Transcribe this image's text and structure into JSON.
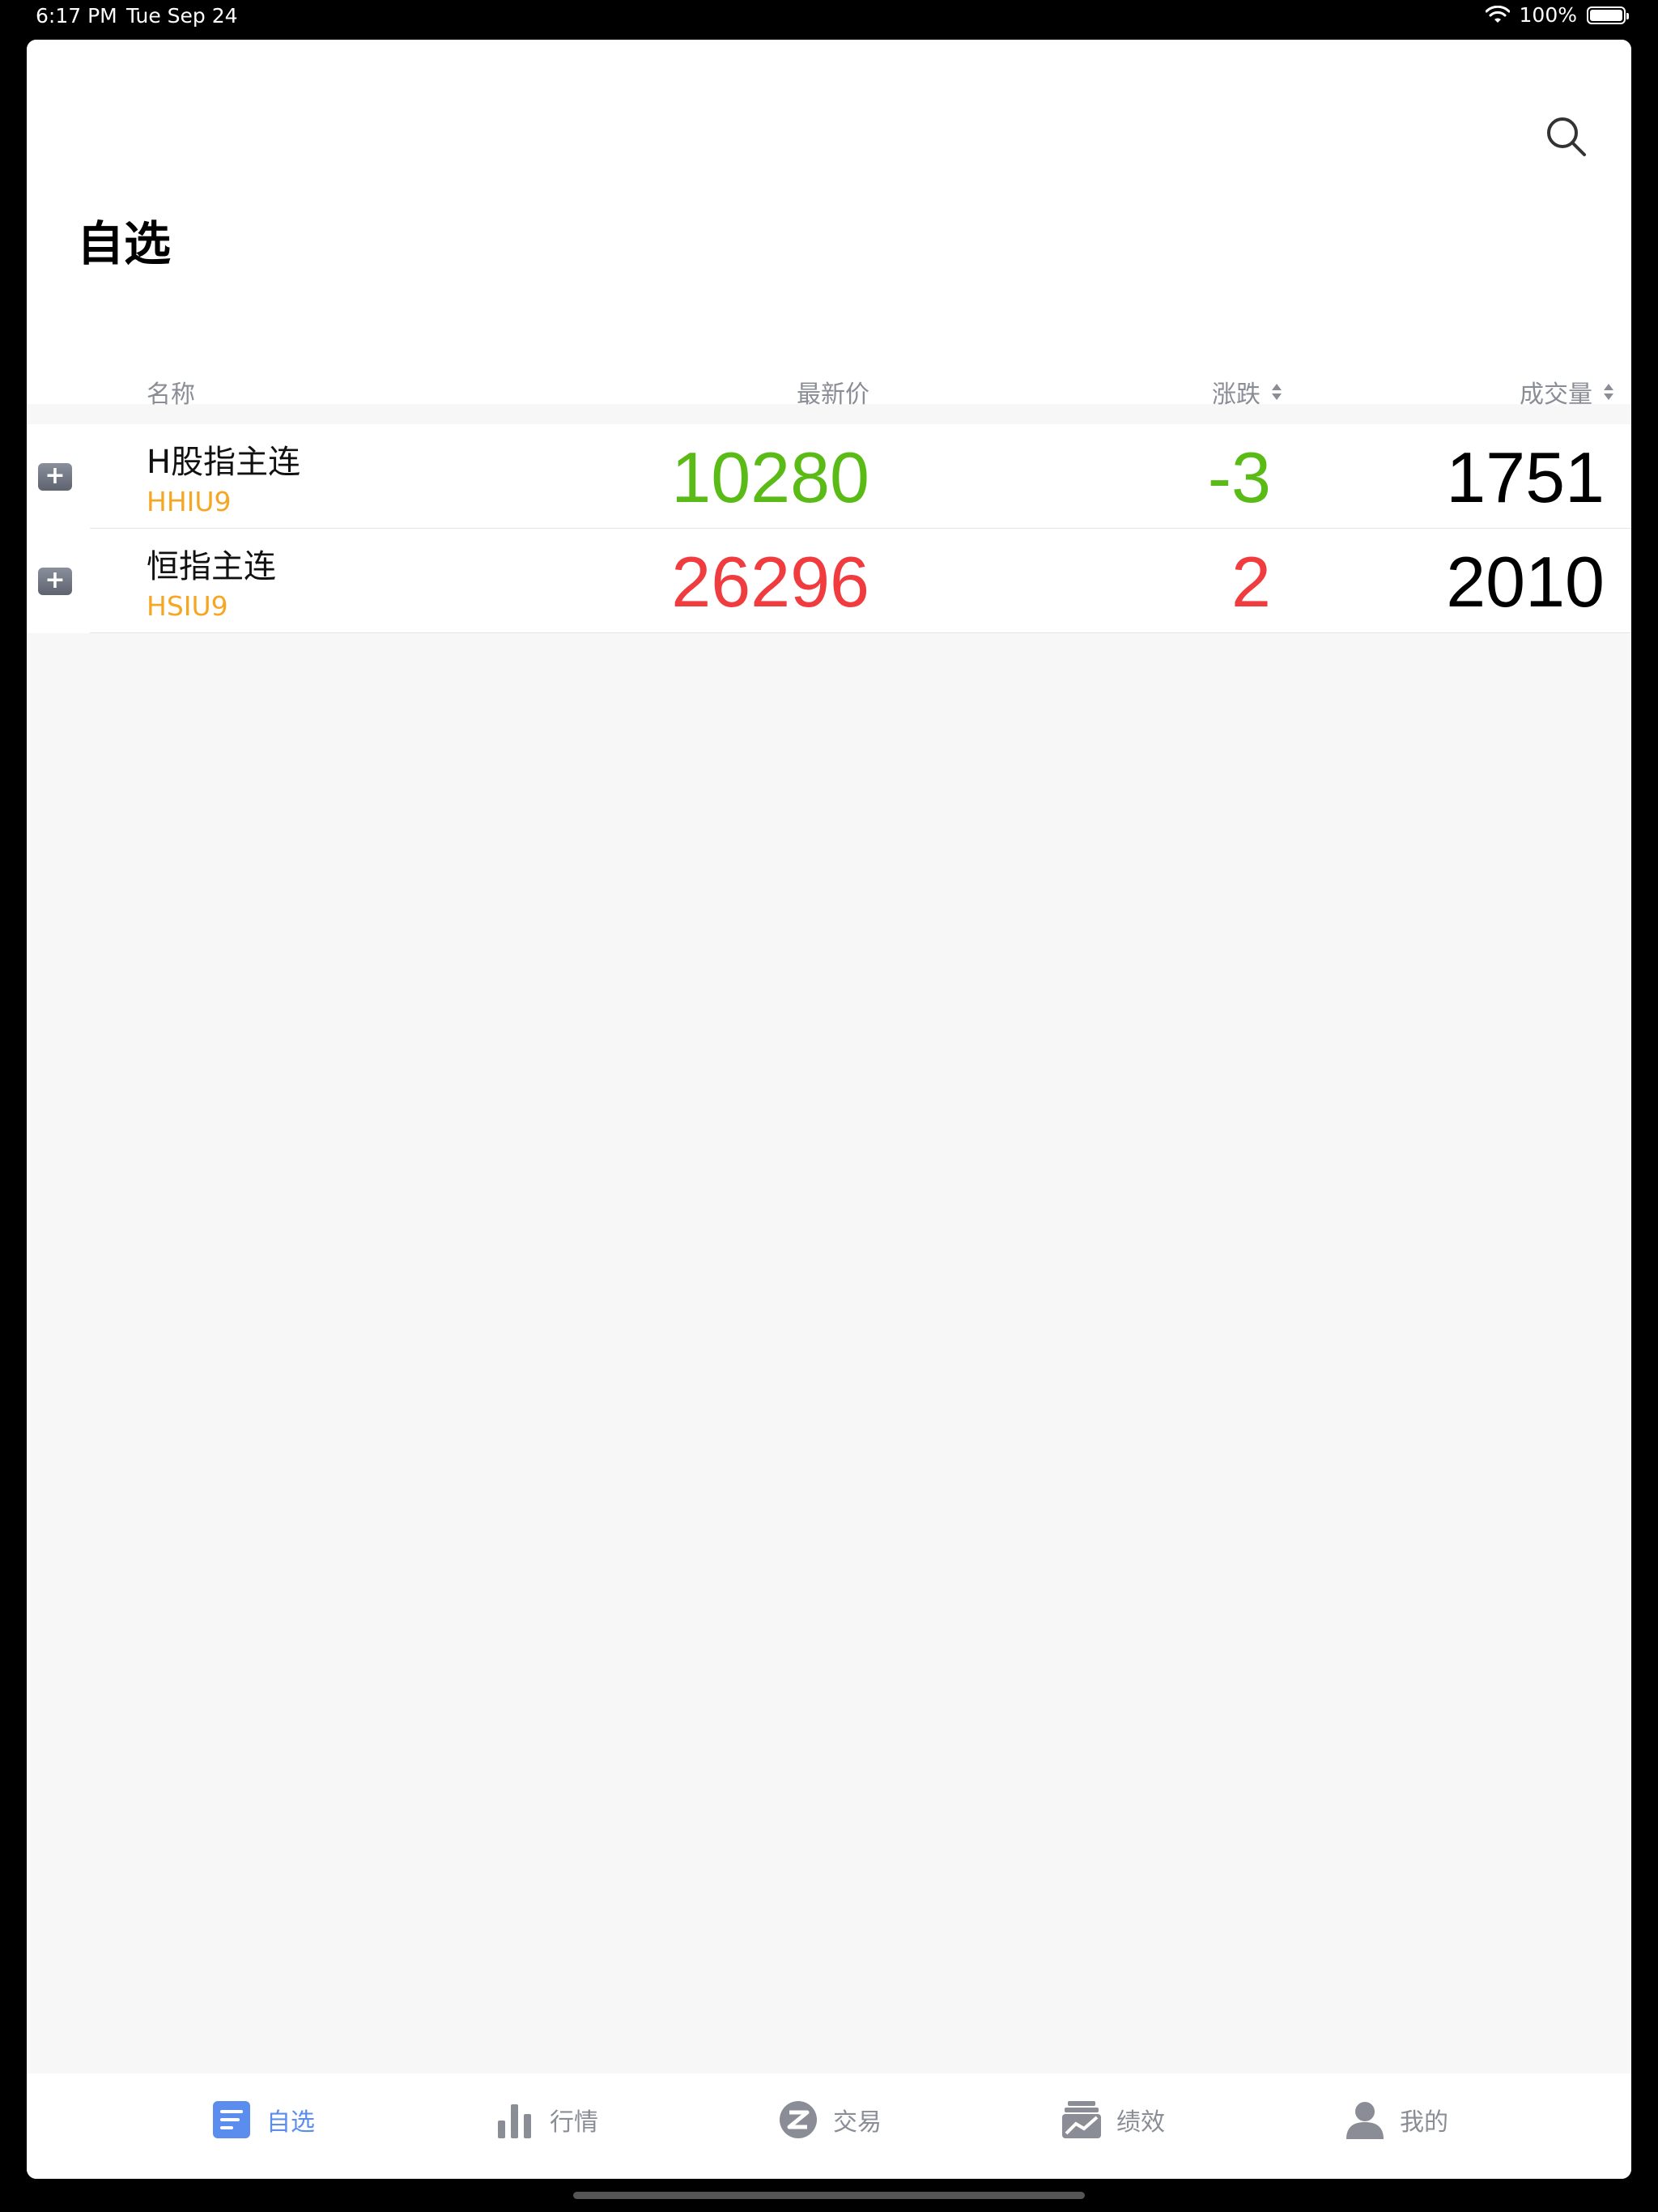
{
  "status_bar": {
    "time": "6:17 PM",
    "date": "Tue Sep 24",
    "battery": "100%"
  },
  "page": {
    "title": "自选"
  },
  "columns": {
    "name": "名称",
    "price": "最新价",
    "change": "涨跌",
    "volume": "成交量"
  },
  "rows": [
    {
      "name": "H股指主连",
      "code": "HHIU9",
      "price": "10280",
      "change": "-3",
      "volume": "1751",
      "direction": "down"
    },
    {
      "name": "恒指主连",
      "code": "HSIU9",
      "price": "26296",
      "change": "2",
      "volume": "2010",
      "direction": "up"
    }
  ],
  "tabs": [
    {
      "label": "自选",
      "icon": "watchlist-icon",
      "active": true
    },
    {
      "label": "行情",
      "icon": "bar-chart-icon",
      "active": false
    },
    {
      "label": "交易",
      "icon": "trade-icon",
      "active": false
    },
    {
      "label": "绩效",
      "icon": "performance-icon",
      "active": false
    },
    {
      "label": "我的",
      "icon": "profile-icon",
      "active": false
    }
  ],
  "colors": {
    "up": "#f03b3f",
    "down": "#5aba16",
    "code": "#f5a623",
    "accent": "#5b8dee",
    "muted": "#8a8d96"
  }
}
